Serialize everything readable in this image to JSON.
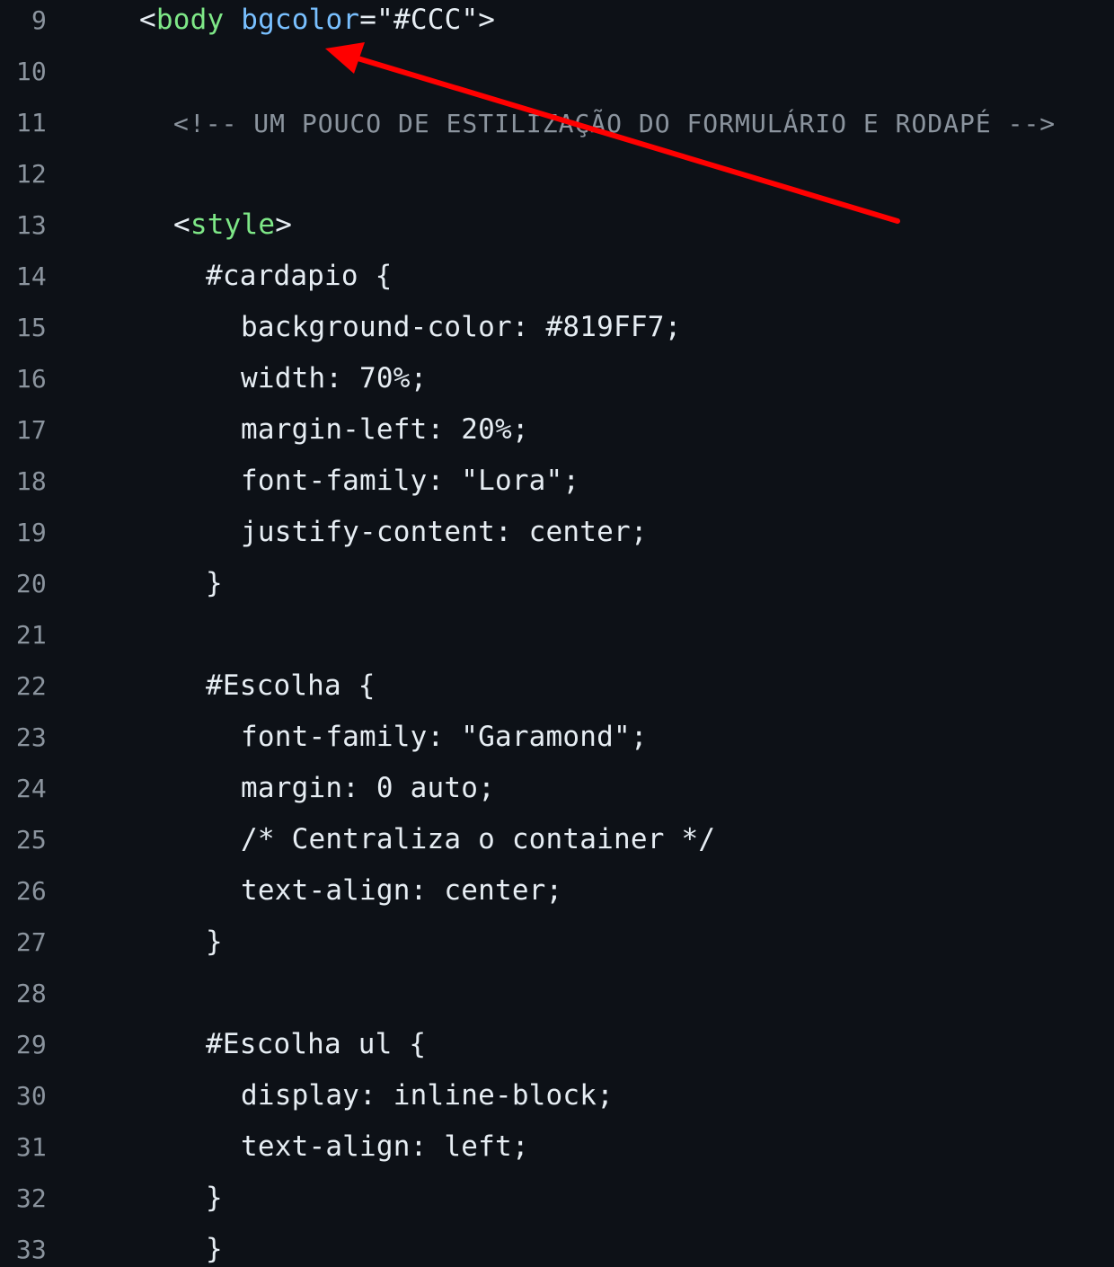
{
  "editor": {
    "lines": [
      {
        "number": "9"
      },
      {
        "number": "10"
      },
      {
        "number": "11"
      },
      {
        "number": "12"
      },
      {
        "number": "13"
      },
      {
        "number": "14"
      },
      {
        "number": "15"
      },
      {
        "number": "16"
      },
      {
        "number": "17"
      },
      {
        "number": "18"
      },
      {
        "number": "19"
      },
      {
        "number": "20"
      },
      {
        "number": "21"
      },
      {
        "number": "22"
      },
      {
        "number": "23"
      },
      {
        "number": "24"
      },
      {
        "number": "25"
      },
      {
        "number": "26"
      },
      {
        "number": "27"
      },
      {
        "number": "28"
      },
      {
        "number": "29"
      },
      {
        "number": "30"
      },
      {
        "number": "31"
      },
      {
        "number": "32"
      },
      {
        "number": "33"
      }
    ],
    "code": {
      "l9_open": "<",
      "l9_tag": "body",
      "l9_attr": " bgcolor",
      "l9_rest": "=\"#CCC\">",
      "l11_comment": "<!-- UM POUCO DE ESTILIZAÇÃO DO FORMULÁRIO E RODAPÉ -->",
      "l13_open": "<",
      "l13_tag": "style",
      "l13_close": ">",
      "l14": "#cardapio {",
      "l15": "background-color: #819FF7;",
      "l16": "width: 70%;",
      "l17": "margin-left: 20%;",
      "l18": "font-family: \"Lora\";",
      "l19": "justify-content: center;",
      "l20": "}",
      "l22": "#Escolha {",
      "l23": "font-family: \"Garamond\";",
      "l24": "margin: 0 auto;",
      "l25": "/* Centraliza o container */",
      "l26": "text-align: center;",
      "l27": "}",
      "l29": "#Escolha ul {",
      "l30": "display: inline-block;",
      "l31": "text-align: left;",
      "l32": "}",
      "l33": "}"
    },
    "colors": {
      "background": "#0d1117",
      "tag": "#7ee787",
      "attribute": "#79c0ff",
      "text": "#e6edf3",
      "comment": "#8b949e",
      "arrow": "#ff0000"
    }
  },
  "annotation": {
    "type": "arrow",
    "color": "#ff0000",
    "points_to": "bgcolor attribute"
  }
}
